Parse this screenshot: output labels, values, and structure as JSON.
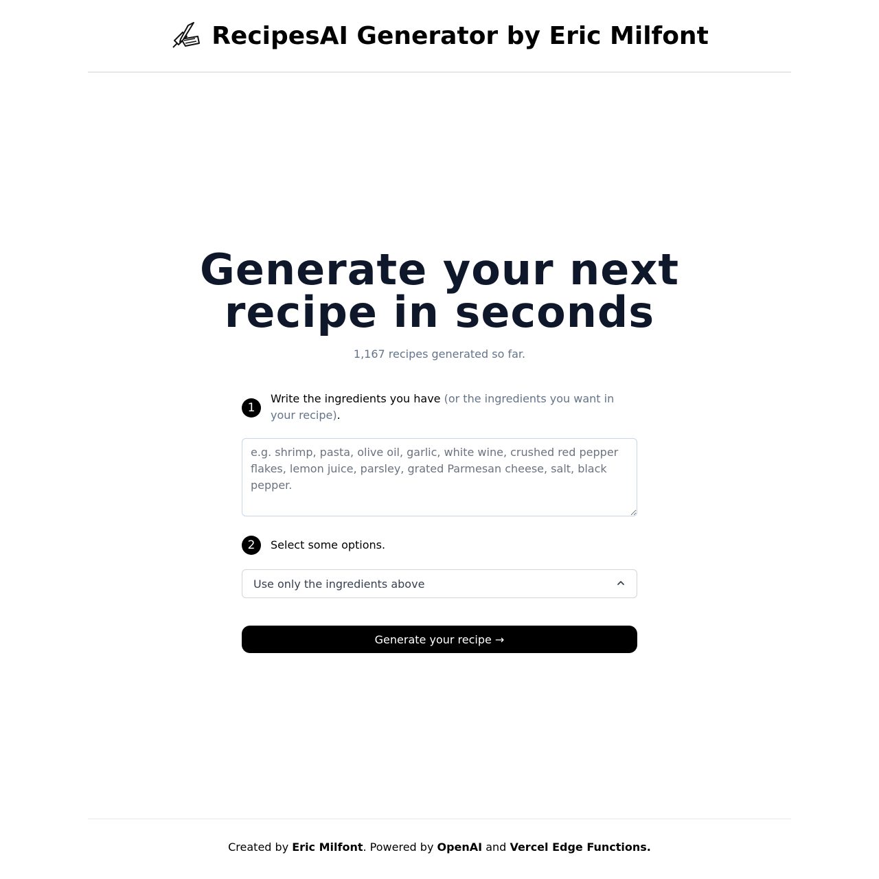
{
  "header": {
    "title": "RecipesAI Generator by Eric Milfont",
    "logo_icon": "writing-hand-icon"
  },
  "hero": {
    "line1": "Generate your next",
    "line2": "recipe in seconds",
    "counter": "1,167 recipes generated so far."
  },
  "step1": {
    "number": "1",
    "text": "Write the ingredients you have",
    "muted": "(or the ingredients you want in your recipe)",
    "suffix": "."
  },
  "ingredients": {
    "value": "",
    "placeholder": "e.g. shrimp, pasta, olive oil, garlic, white wine, crushed red pepper flakes, lemon juice, parsley, grated Parmesan cheese, salt, black pepper."
  },
  "step2": {
    "number": "2",
    "text": "Select some options."
  },
  "options_select": {
    "selected": "Use only the ingredients above",
    "icon": "chevron-up-icon"
  },
  "generate_button": {
    "label": "Generate your recipe →"
  },
  "footer": {
    "created_by": "Created by",
    "author": "Eric Milfont",
    "powered_by": ". Powered by",
    "openai": "OpenAI",
    "and": "and",
    "vercel": "Vercel Edge Functions."
  }
}
